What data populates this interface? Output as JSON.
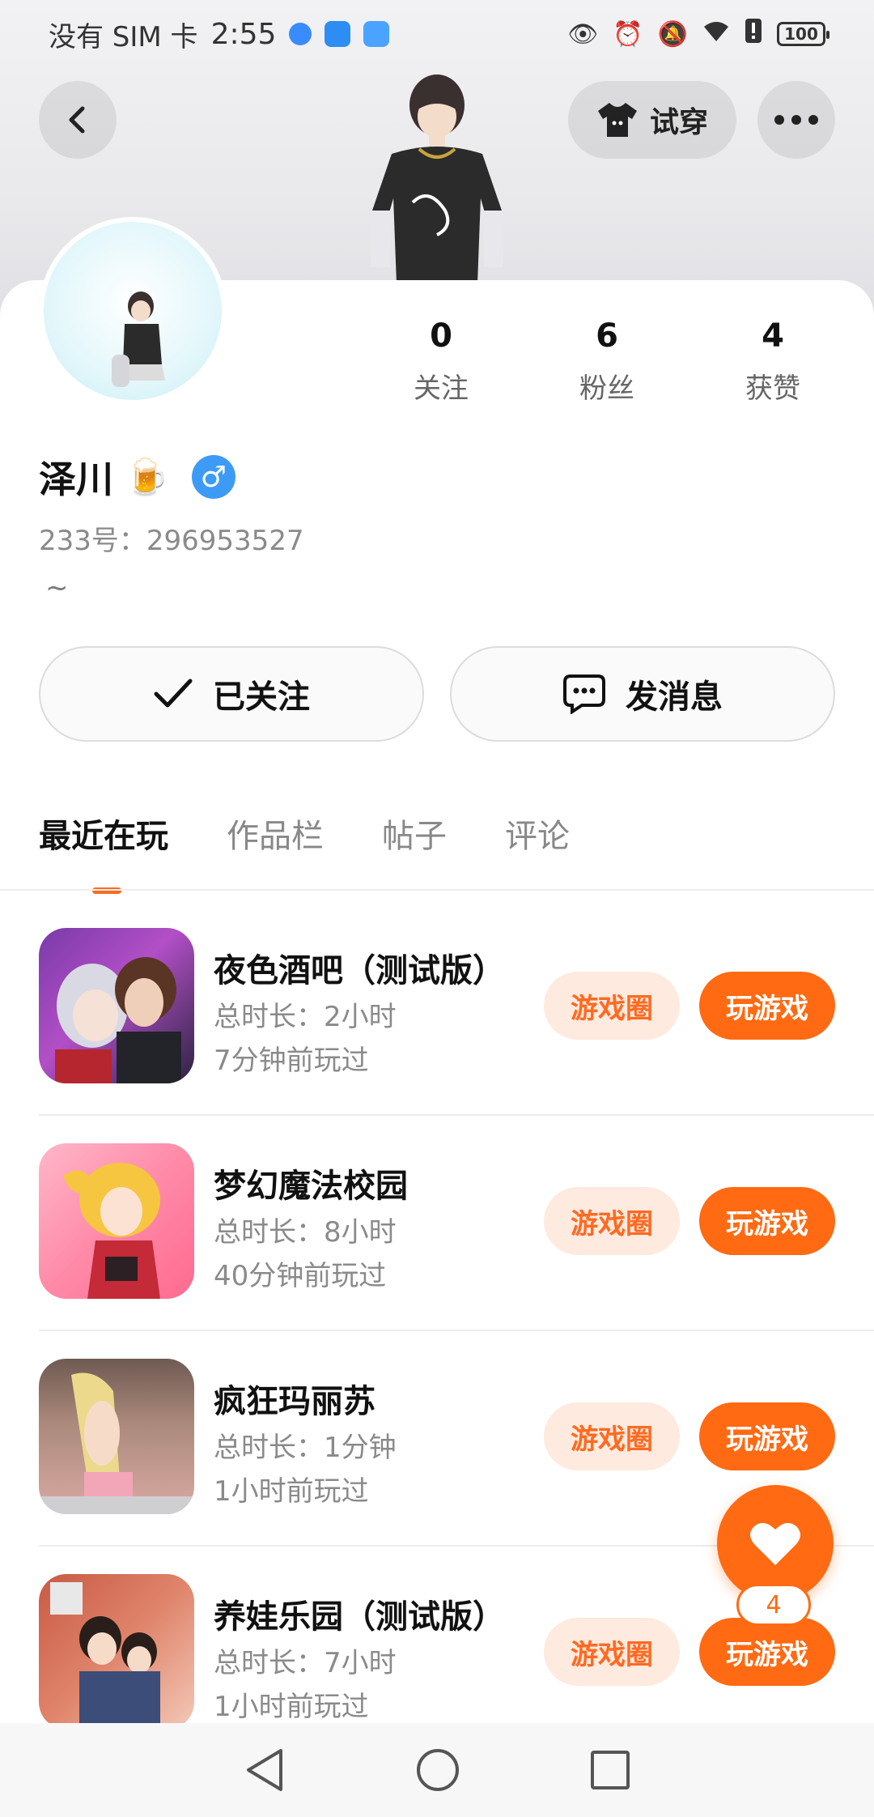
{
  "status_bar": {
    "carrier": "没有 SIM 卡",
    "time": "2:55",
    "battery": "100"
  },
  "header": {
    "tryon_label": "试穿"
  },
  "profile": {
    "stats": [
      {
        "value": "0",
        "label": "关注"
      },
      {
        "value": "6",
        "label": "粉丝"
      },
      {
        "value": "4",
        "label": "获赞"
      }
    ],
    "name": "泽川",
    "gender_symbol": "♂",
    "uid": "233号：296953527",
    "bio": "~"
  },
  "actions": {
    "follow_label": "已关注",
    "message_label": "发消息"
  },
  "tabs": [
    "最近在玩",
    "作品栏",
    "帖子",
    "评论"
  ],
  "games": [
    {
      "title": "夜色酒吧（测试版）",
      "duration": "总时长：2小时",
      "last_played": "7分钟前玩过",
      "circle_label": "游戏圈",
      "play_label": "玩游戏"
    },
    {
      "title": "梦幻魔法校园",
      "duration": "总时长：8小时",
      "last_played": "40分钟前玩过",
      "circle_label": "游戏圈",
      "play_label": "玩游戏"
    },
    {
      "title": "疯狂玛丽苏",
      "duration": "总时长：1分钟",
      "last_played": "1小时前玩过",
      "circle_label": "游戏圈",
      "play_label": "玩游戏"
    },
    {
      "title": "养娃乐园（测试版）",
      "duration": "总时长：7小时",
      "last_played": "1小时前玩过",
      "circle_label": "游戏圈",
      "play_label": "玩游戏"
    }
  ],
  "like_fab": {
    "count": "4"
  },
  "colors": {
    "accent": "#ff6a12",
    "accent_light": "#ffeadf",
    "gender_blue": "#3d9bf6"
  }
}
